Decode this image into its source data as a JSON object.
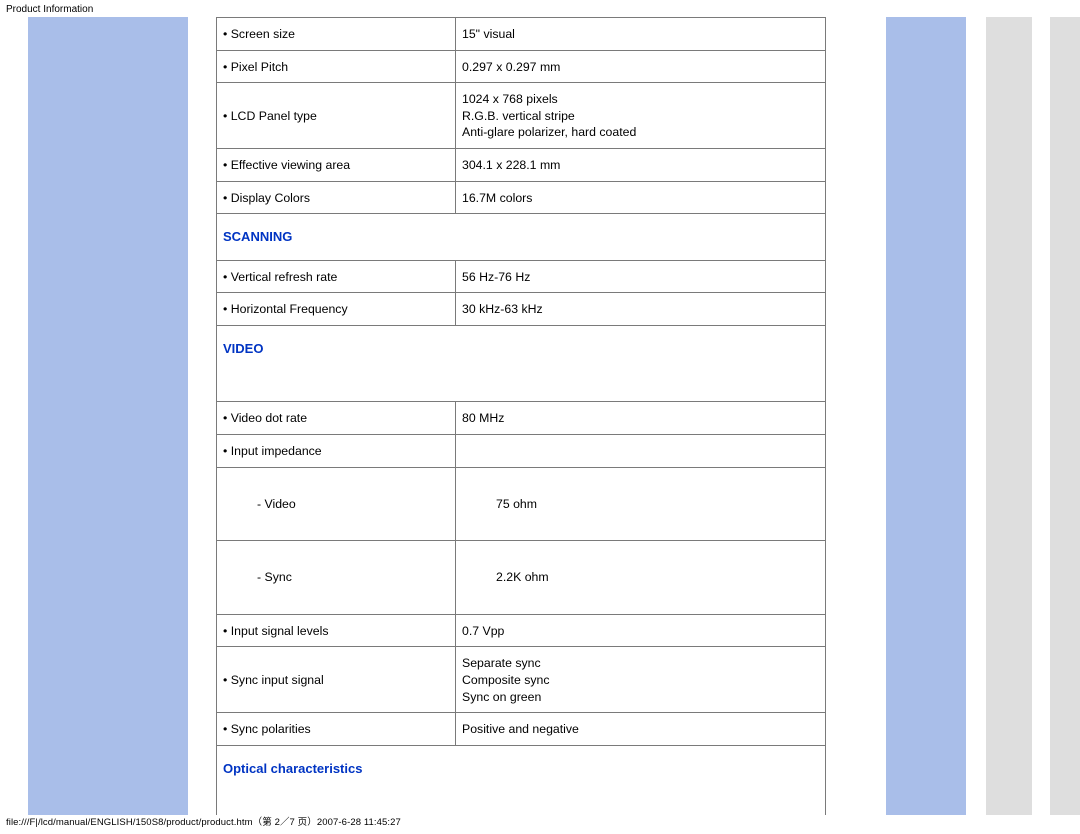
{
  "page_header": "Product Information",
  "sections": {
    "display_rows": [
      {
        "label": "•  Screen size",
        "value": "15\" visual"
      },
      {
        "label": "•  Pixel Pitch",
        "value": "0.297 x 0.297 mm"
      },
      {
        "label": "•  LCD Panel type",
        "value": "1024 x 768 pixels\nR.G.B. vertical stripe\nAnti-glare polarizer, hard coated"
      },
      {
        "label": "•  Effective viewing area",
        "value": "304.1 x 228.1 mm"
      },
      {
        "label": "•  Display Colors",
        "value": "16.7M colors"
      }
    ],
    "scanning": {
      "title": "SCANNING",
      "rows": [
        {
          "label": "•  Vertical refresh rate",
          "value": "56 Hz-76 Hz"
        },
        {
          "label": "•  Horizontal Frequency",
          "value": "30 kHz-63 kHz"
        }
      ]
    },
    "video": {
      "title": "VIDEO",
      "rows": [
        {
          "label": "•  Video dot rate",
          "value": "80 MHz"
        },
        {
          "label": "•  Input impedance",
          "value": ""
        },
        {
          "label": "- Video",
          "value": "75 ohm",
          "indent": true
        },
        {
          "label": "- Sync",
          "value": "2.2K ohm",
          "indent": true
        },
        {
          "label": "•  Input signal levels",
          "value": "0.7 Vpp"
        },
        {
          "label": "•  Sync input signal",
          "value": "Separate sync\nComposite sync\nSync on green"
        },
        {
          "label": "•  Sync polarities",
          "value": "Positive and negative"
        }
      ]
    },
    "optical": {
      "title": "Optical characteristics"
    }
  },
  "footer_path": "file:///F|/lcd/manual/ENGLISH/150S8/product/product.htm（第 2／7 页）2007-6-28 11:45:27"
}
